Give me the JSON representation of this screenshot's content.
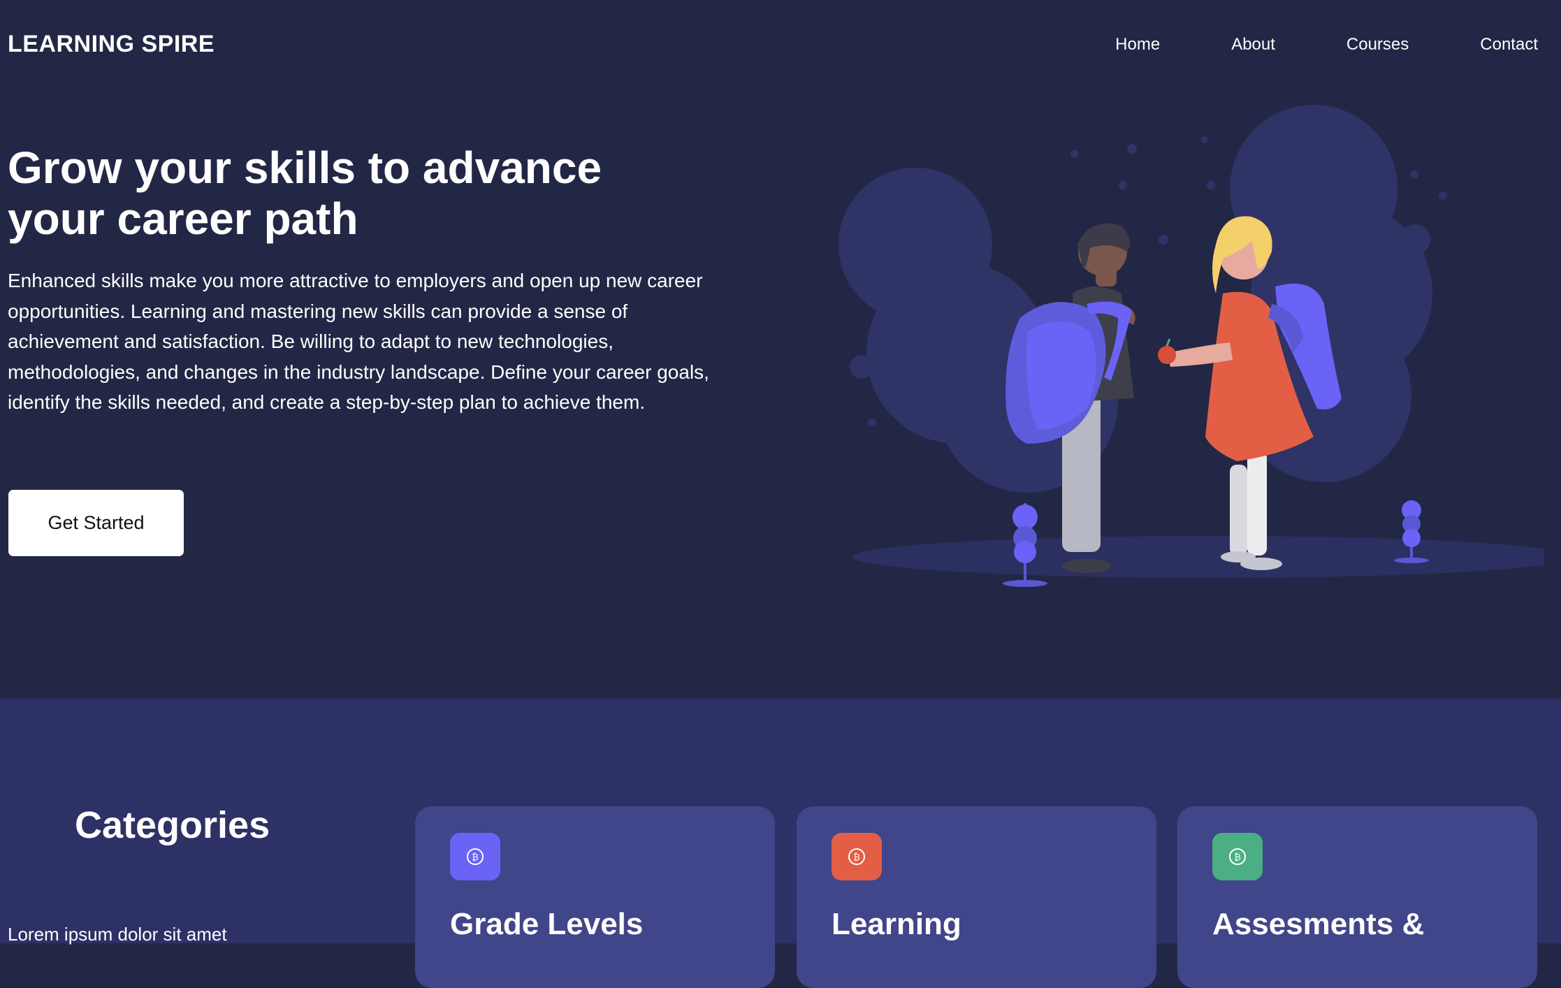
{
  "brand": {
    "name": "LEARNING SPIRE"
  },
  "nav": {
    "items": [
      "Home",
      "About",
      "Courses",
      "Contact"
    ]
  },
  "hero": {
    "headline_line1": "Grow your skills to advance",
    "headline_line2": "your career path",
    "description": "Enhanced skills make you more attractive to employers and open up new career opportunities. Learning and mastering new skills can provide a sense of achievement and satisfaction. Be willing to adapt to new technologies, methodologies, and changes in the industry landscape. Define your career goals, identify the skills needed, and create a step-by-step plan to achieve them.",
    "cta_label": "Get Started"
  },
  "categories": {
    "title": "Categories",
    "subtitle": "Lorem ipsum dolor sit amet",
    "cards": [
      {
        "title": "Grade Levels",
        "icon": "bitcoin-icon",
        "color": "#6a63f6"
      },
      {
        "title": "Learning",
        "icon": "bitcoin-icon",
        "color": "#e25f45"
      },
      {
        "title": "Assesments &",
        "icon": "bitcoin-icon",
        "color": "#4caf84"
      }
    ]
  },
  "colors": {
    "hero_bg": "#222745",
    "band_bg": "#2e3165",
    "card_bg": "#41468a",
    "accent_purple": "#6a63f6"
  }
}
